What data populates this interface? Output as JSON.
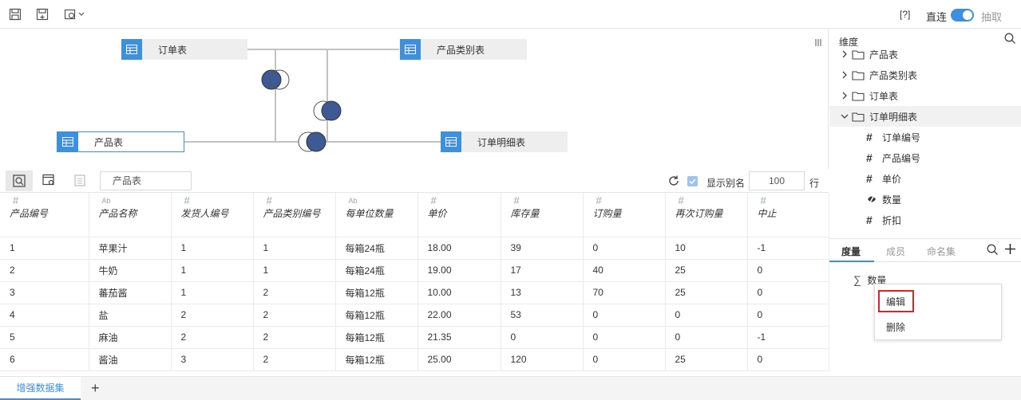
{
  "topbar": {
    "help": "[?]",
    "direct_label": "直连",
    "extract_label": "抽取"
  },
  "canvas": {
    "nodes": {
      "orders": "订单表",
      "categories": "产品类别表",
      "products": "产品表",
      "order_details": "订单明细表"
    }
  },
  "data_toolbar": {
    "search_value": "产品表",
    "alias_label": "显示别名",
    "rows_value": "100",
    "rows_unit": "行"
  },
  "table": {
    "columns": [
      {
        "type": "#",
        "name": "产品编号"
      },
      {
        "type": "Ab",
        "name": "产品名称"
      },
      {
        "type": "#",
        "name": "发货人编号"
      },
      {
        "type": "#",
        "name": "产品类别编号"
      },
      {
        "type": "Ab",
        "name": "每单位数量"
      },
      {
        "type": "#",
        "name": "单价"
      },
      {
        "type": "#",
        "name": "库存量"
      },
      {
        "type": "#",
        "name": "订购量"
      },
      {
        "type": "#",
        "name": "再次订购量"
      },
      {
        "type": "#",
        "name": "中止"
      }
    ],
    "rows": [
      [
        "1",
        "苹果汁",
        "1",
        "1",
        "每箱24瓶",
        "18.00",
        "39",
        "0",
        "10",
        "-1"
      ],
      [
        "2",
        "牛奶",
        "1",
        "1",
        "每箱24瓶",
        "19.00",
        "17",
        "40",
        "25",
        "0"
      ],
      [
        "3",
        "蕃茄酱",
        "1",
        "2",
        "每箱12瓶",
        "10.00",
        "13",
        "70",
        "25",
        "0"
      ],
      [
        "4",
        "盐",
        "2",
        "2",
        "每箱12瓶",
        "22.00",
        "53",
        "0",
        "0",
        "0"
      ],
      [
        "5",
        "麻油",
        "2",
        "2",
        "每箱12瓶",
        "21.35",
        "0",
        "0",
        "0",
        "-1"
      ],
      [
        "6",
        "酱油",
        "3",
        "2",
        "每箱12瓶",
        "25.00",
        "120",
        "0",
        "25",
        "0"
      ]
    ]
  },
  "bottom": {
    "tab_label": "增强数据集",
    "add": "+"
  },
  "right_panel": {
    "title": "维度",
    "tree": [
      {
        "label": "产品表",
        "kind": "folder",
        "expanded": false
      },
      {
        "label": "产品类别表",
        "kind": "folder",
        "expanded": false
      },
      {
        "label": "订单表",
        "kind": "folder",
        "expanded": false
      },
      {
        "label": "订单明细表",
        "kind": "folder",
        "expanded": true
      },
      {
        "label": "订单编号",
        "kind": "number"
      },
      {
        "label": "产品编号",
        "kind": "number"
      },
      {
        "label": "单价",
        "kind": "number"
      },
      {
        "label": "数量",
        "kind": "measure"
      },
      {
        "label": "折扣",
        "kind": "number"
      }
    ],
    "tabs": [
      "度量",
      "成员",
      "命名集"
    ],
    "measure_item": "数量",
    "context_menu": [
      "编辑",
      "删除"
    ]
  },
  "colors": {
    "accent": "#3d8fe0",
    "join_fill": "#3e5a94",
    "highlight": "#d9262b"
  }
}
